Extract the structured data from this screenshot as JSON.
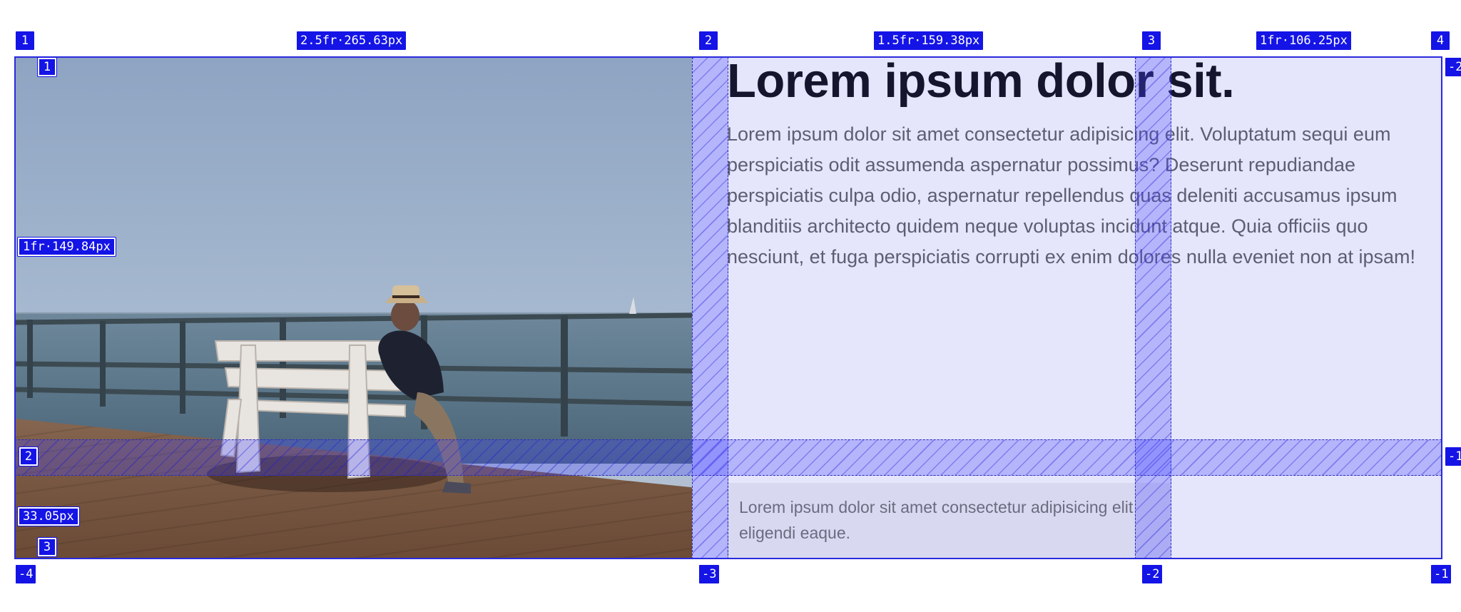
{
  "content": {
    "heading": "Lorem ipsum dolor sit.",
    "paragraph": "Lorem ipsum dolor sit amet consectetur adipisicing elit. Voluptatum sequi eum perspiciatis odit assumenda aspernatur possimus? Deserunt repudiandae perspiciatis culpa odio, aspernatur repellendus quas deleniti accusamus ipsum blanditiis architecto quidem neque voluptas incidunt atque. Quia officiis quo nesciunt, et fuga perspiciatis corrupti ex enim dolores nulla eveniet non at ipsam!",
    "caption": "Lorem ipsum dolor sit amet consectetur adipisicing elit eligendi eaque.",
    "image_alt": "Man in a hat sitting on a white bench on a pier overlooking the ocean"
  },
  "grid_overlay": {
    "column_sizes": [
      "2.5fr·265.63px",
      "1.5fr·159.38px",
      "1fr·106.25px"
    ],
    "row_sizes": [
      "1fr·149.84px",
      "33.05px"
    ],
    "column_line_numbers": [
      "1",
      "2",
      "3",
      "4"
    ],
    "column_line_negative": [
      "-4",
      "-3",
      "-2",
      "-1"
    ],
    "row_line_numbers": [
      "1",
      "2",
      "3"
    ],
    "row_line_negative": [
      "-2",
      "-1"
    ],
    "colors": {
      "badge": "#1414e6",
      "gap_fill": "#5050ff",
      "container_bg": "#e5e5fb"
    }
  }
}
